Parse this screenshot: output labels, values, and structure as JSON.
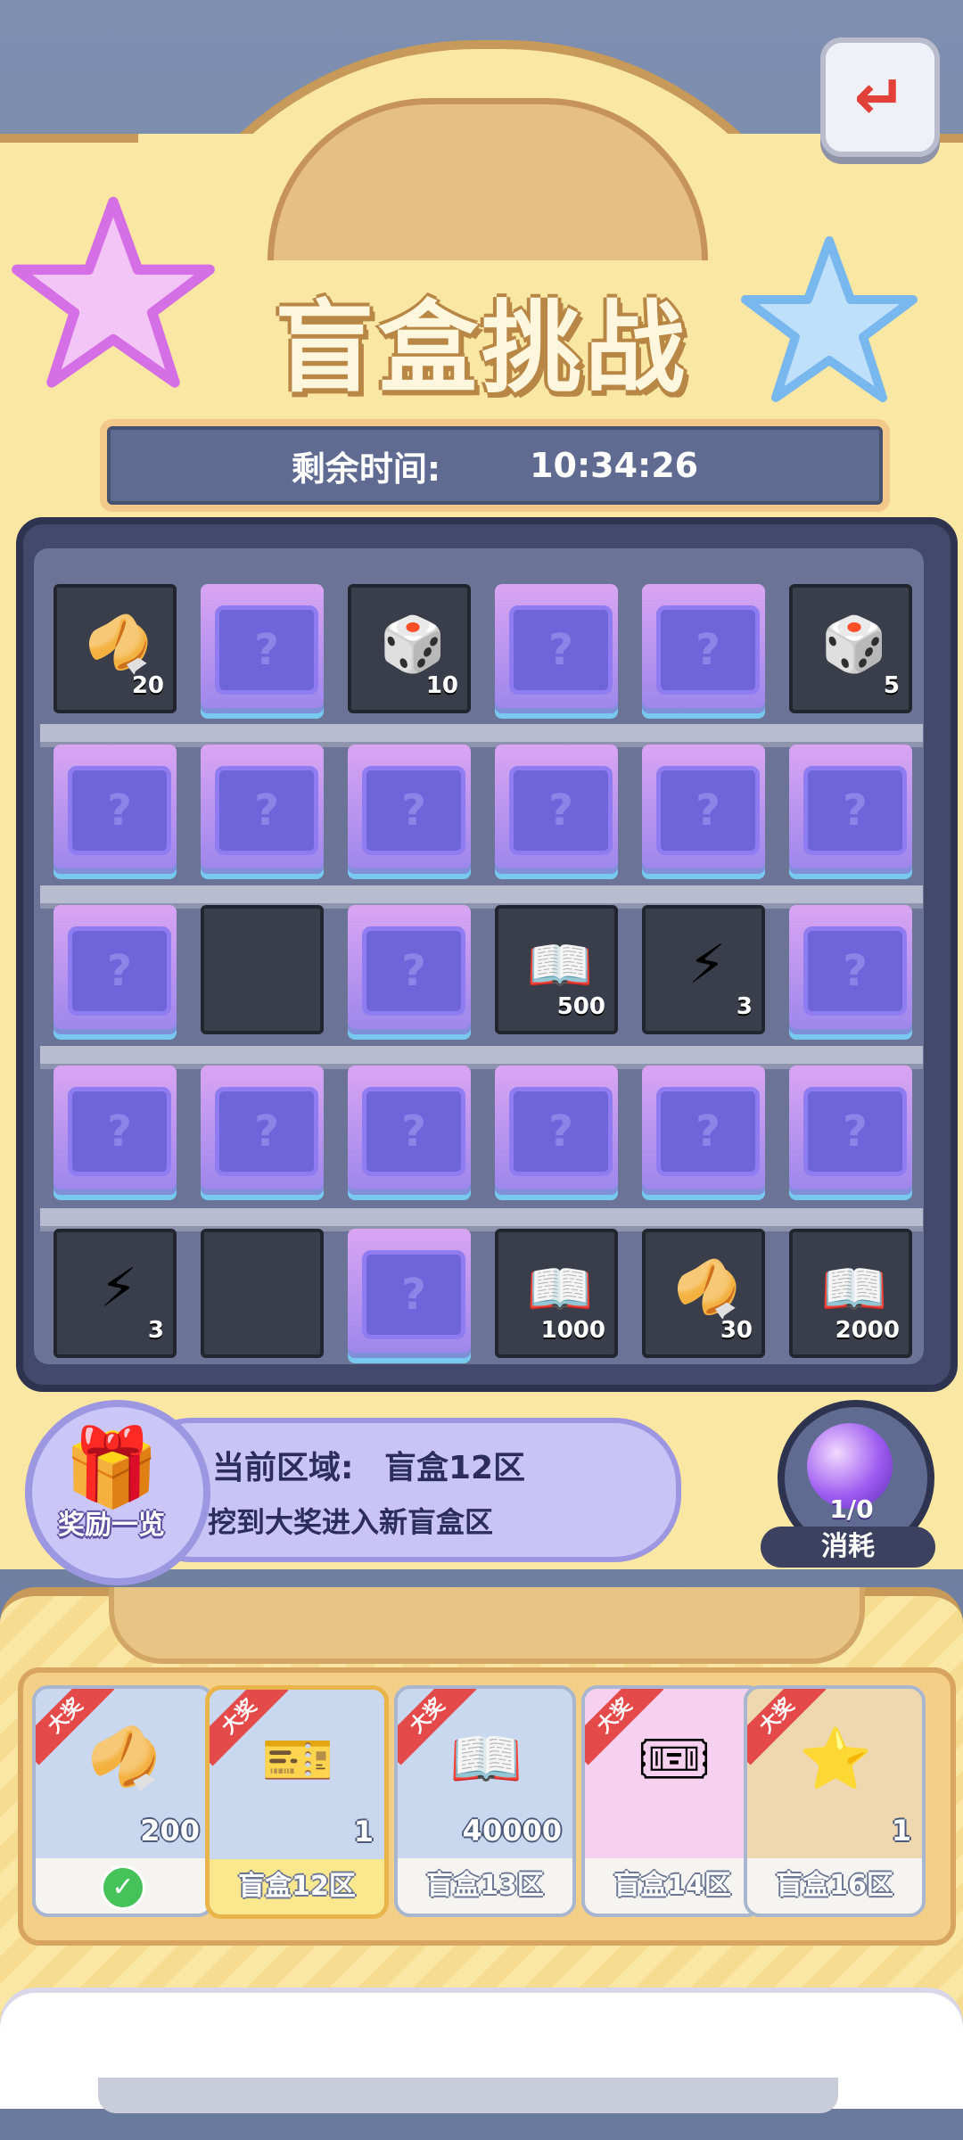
{
  "title": "盲盒挑战",
  "timer": {
    "label": "剩余时间:",
    "value": "10:34:26"
  },
  "grid": [
    [
      {
        "state": "open",
        "icon": "fortune-cookie-icon",
        "glyph": "🥠",
        "count": "20"
      },
      {
        "state": "closed"
      },
      {
        "state": "open",
        "icon": "dice-icon",
        "glyph": "🎲",
        "count": "10"
      },
      {
        "state": "closed"
      },
      {
        "state": "closed"
      },
      {
        "state": "open",
        "icon": "dice-icon",
        "glyph": "🎲",
        "count": "5"
      }
    ],
    [
      {
        "state": "closed"
      },
      {
        "state": "closed"
      },
      {
        "state": "closed"
      },
      {
        "state": "closed"
      },
      {
        "state": "closed"
      },
      {
        "state": "closed"
      }
    ],
    [
      {
        "state": "closed"
      },
      {
        "state": "empty"
      },
      {
        "state": "closed"
      },
      {
        "state": "open",
        "icon": "book-icon",
        "glyph": "📖",
        "count": "500"
      },
      {
        "state": "open",
        "icon": "lightning-icon",
        "glyph": "⚡",
        "count": "3"
      },
      {
        "state": "closed"
      }
    ],
    [
      {
        "state": "closed"
      },
      {
        "state": "closed"
      },
      {
        "state": "closed"
      },
      {
        "state": "closed"
      },
      {
        "state": "closed"
      },
      {
        "state": "closed"
      }
    ],
    [
      {
        "state": "open",
        "icon": "lightning-icon",
        "glyph": "⚡",
        "count": "3"
      },
      {
        "state": "empty"
      },
      {
        "state": "closed"
      },
      {
        "state": "open",
        "icon": "book-icon",
        "glyph": "📖",
        "count": "1000"
      },
      {
        "state": "open",
        "icon": "fortune-cookie-icon",
        "glyph": "🥠",
        "count": "30"
      },
      {
        "state": "open",
        "icon": "book-icon",
        "glyph": "📖",
        "count": "2000"
      }
    ]
  ],
  "closed_mark": "?",
  "region": {
    "gift_label": "奖励一览",
    "current_label": "当前区域:",
    "current_value": "盲盒12区",
    "hint": "挖到大奖进入新盲盒区"
  },
  "orb": {
    "count": "1/0",
    "consume_label": "消耗"
  },
  "rewards": [
    {
      "badge": "大奖",
      "icon": "fortune-cookie-icon",
      "glyph": "🥠",
      "count": "200",
      "footer": "",
      "claimed": true,
      "tone": "blue"
    },
    {
      "badge": "大奖",
      "icon": "green-ticket-icon",
      "glyph": "🎫",
      "count": "1",
      "footer": "盲盒12区",
      "claimed": false,
      "tone": "blue",
      "active": true
    },
    {
      "badge": "大奖",
      "icon": "book-icon",
      "glyph": "📖",
      "count": "40000",
      "footer": "盲盒13区",
      "claimed": false,
      "tone": "blue"
    },
    {
      "badge": "大奖",
      "icon": "blue-ticket-icon",
      "glyph": "🎟",
      "count": "",
      "footer": "盲盒14区",
      "claimed": false,
      "tone": "pink"
    },
    {
      "badge": "大奖",
      "icon": "star-card-icon",
      "glyph": "⭐",
      "count": "1",
      "footer": "盲盒16区",
      "claimed": false,
      "tone": "tan"
    }
  ],
  "back_glyph": "↵",
  "colors": {
    "accent": "#fbe7a4",
    "closed_box": "#9b86ec",
    "badge": "#e44a4a"
  }
}
